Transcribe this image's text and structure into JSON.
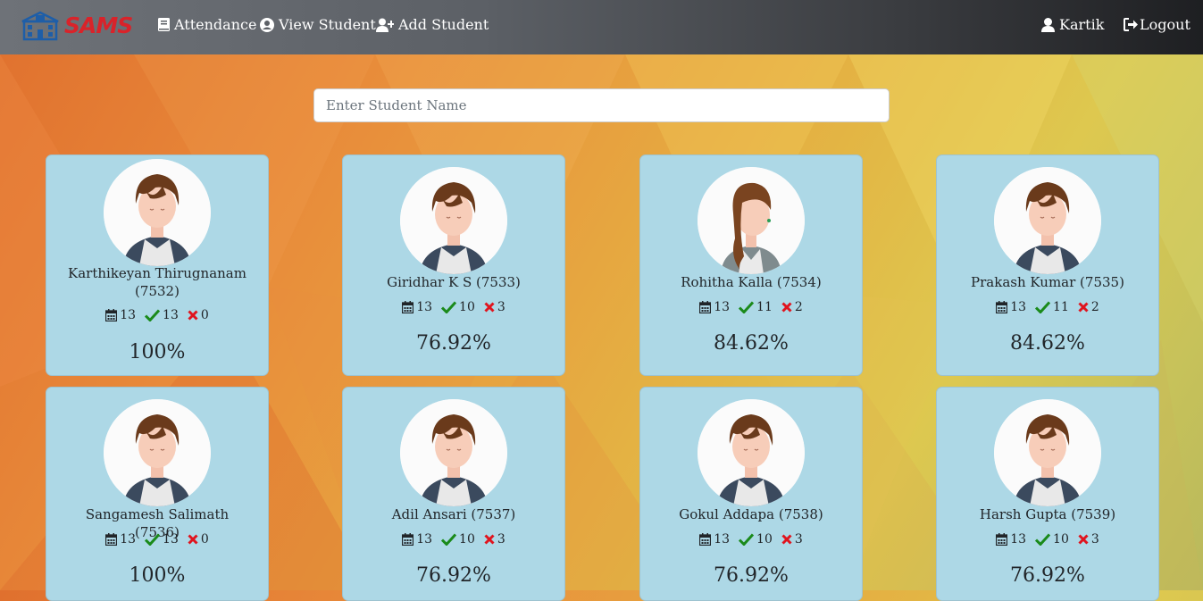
{
  "nav": {
    "logo_text": "SAMS",
    "links": [
      {
        "label": "Attendance"
      },
      {
        "label": "View Student"
      },
      {
        "label": "Add Student"
      }
    ],
    "user": "Kartik",
    "logout": "Logout"
  },
  "search": {
    "placeholder": "Enter Student Name",
    "value": ""
  },
  "students": [
    {
      "name": "Karthikeyan Thirugnanam (7532)",
      "total": "13",
      "present": "13",
      "absent": "0",
      "percent": "100%",
      "gender": "male"
    },
    {
      "name": "Giridhar K S (7533)",
      "total": "13",
      "present": "10",
      "absent": "3",
      "percent": "76.92%",
      "gender": "male"
    },
    {
      "name": "Rohitha Kalla (7534)",
      "total": "13",
      "present": "11",
      "absent": "2",
      "percent": "84.62%",
      "gender": "female"
    },
    {
      "name": "Prakash Kumar (7535)",
      "total": "13",
      "present": "11",
      "absent": "2",
      "percent": "84.62%",
      "gender": "male"
    },
    {
      "name": "Sangamesh Salimath (7536)",
      "total": "13",
      "present": "13",
      "absent": "0",
      "percent": "100%",
      "gender": "male"
    },
    {
      "name": "Adil Ansari (7537)",
      "total": "13",
      "present": "10",
      "absent": "3",
      "percent": "76.92%",
      "gender": "male"
    },
    {
      "name": "Gokul Addapa (7538)",
      "total": "13",
      "present": "10",
      "absent": "3",
      "percent": "76.92%",
      "gender": "male"
    },
    {
      "name": "Harsh Gupta (7539)",
      "total": "13",
      "present": "10",
      "absent": "3",
      "percent": "76.92%",
      "gender": "male"
    }
  ],
  "colors": {
    "card_bg": "#add8e6",
    "present": "#1a8a1a",
    "absent": "#e0141e",
    "logo": "#d9232a"
  }
}
